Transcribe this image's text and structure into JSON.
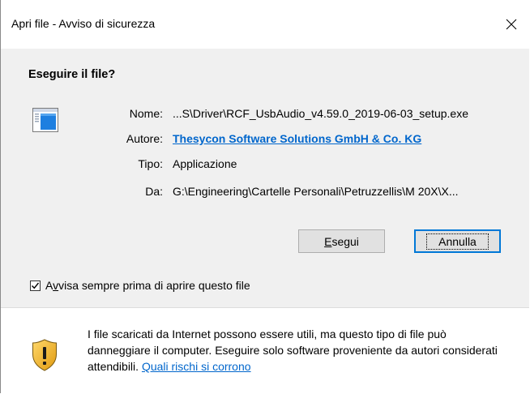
{
  "window": {
    "title": "Apri file - Avviso di sicurezza",
    "close_glyph": "✕"
  },
  "heading": "Eseguire il file?",
  "file_icon": "application-window-icon",
  "fields": [
    {
      "label": "Nome:",
      "value": "...S\\Driver\\RCF_UsbAudio_v4.59.0_2019-06-03_setup.exe"
    },
    {
      "label": "Autore:",
      "value": "Thesycon Software Solutions GmbH & Co. KG"
    },
    {
      "label": "Tipo:",
      "value": "Applicazione"
    },
    {
      "label": "Da:",
      "value": "G:\\Engineering\\Cartelle Personali\\Petruzzellis\\M 20X\\X..."
    }
  ],
  "buttons": {
    "run_access_key": "E",
    "run_rest": "segui",
    "cancel": "Annulla"
  },
  "checkbox": {
    "checked": true,
    "label_before": "A",
    "label_access_key": "v",
    "label_after": "visa sempre prima di aprire questo file"
  },
  "footer": {
    "warning_text": "I file scaricati da Internet possono essere utili, ma questo tipo di file può danneggiare il computer. Eseguire solo software proveniente da autori considerati attendibili.",
    "risk_link": "Quali rischi si corrono"
  },
  "colors": {
    "link": "#0066cc",
    "default_button_border": "#0078d7",
    "body_background": "#f0f0f0"
  }
}
